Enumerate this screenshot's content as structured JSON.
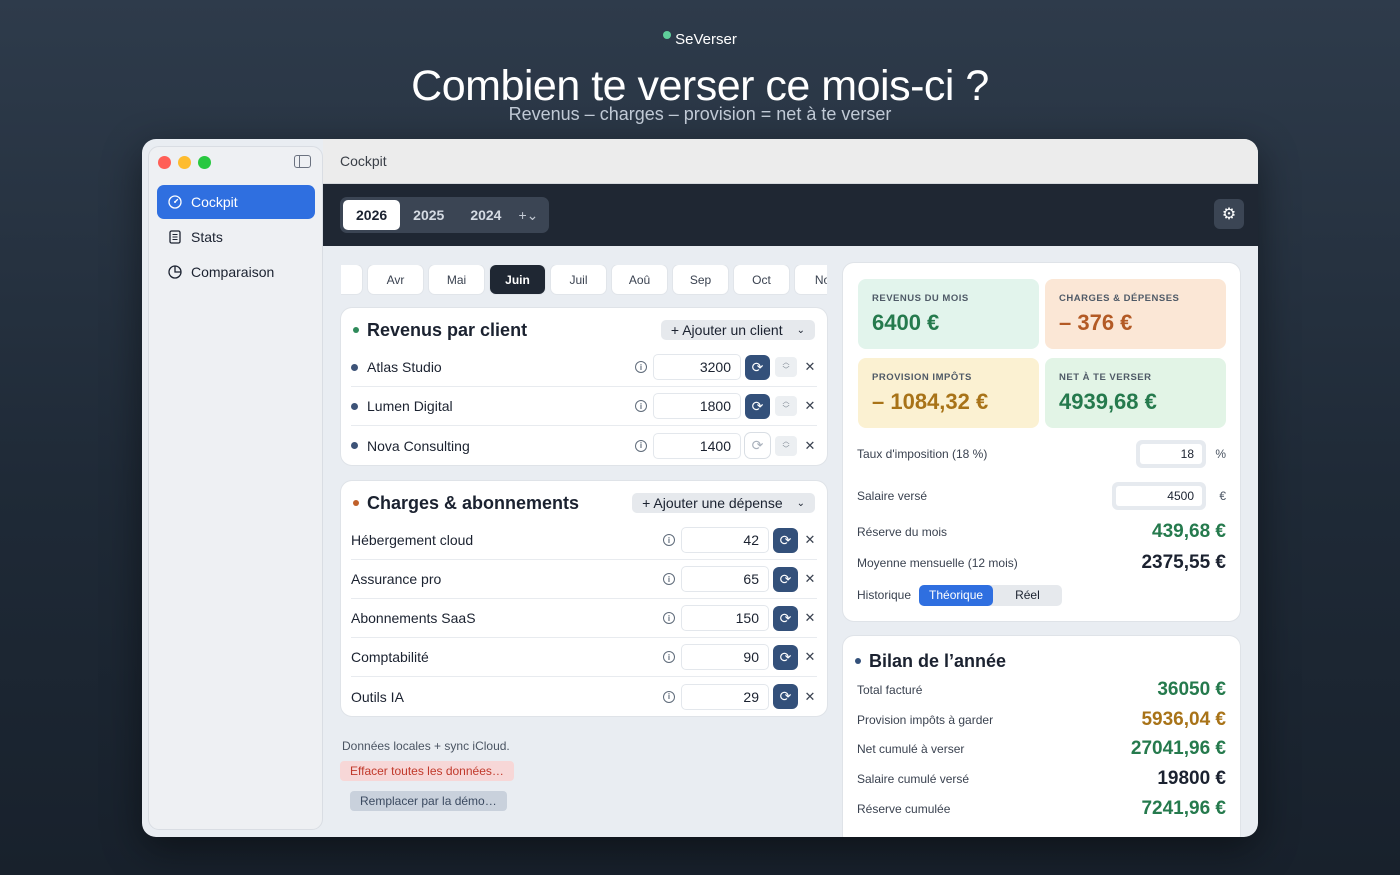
{
  "hero": {
    "brand": "SeVerser",
    "title": "Combien te verser ce mois-ci ?",
    "subtitle": "Revenus – charges – provision = net à te verser"
  },
  "sidebar": {
    "items": [
      {
        "label": "Cockpit",
        "icon": "gauge-icon"
      },
      {
        "label": "Stats",
        "icon": "document-icon"
      },
      {
        "label": "Comparaison",
        "icon": "pie-icon"
      }
    ]
  },
  "window": {
    "title": "Cockpit"
  },
  "years": {
    "items": [
      "2026",
      "2025",
      "2024"
    ],
    "selected": "2026",
    "add_label": "+⌄"
  },
  "months": {
    "items": [
      "ar",
      "Avr",
      "Mai",
      "Juin",
      "Juil",
      "Aoû",
      "Sep",
      "Oct",
      "No"
    ],
    "selected": "Juin"
  },
  "revenus": {
    "title": "Revenus par client",
    "add_label": "+ Ajouter un client",
    "rows": [
      {
        "name": "Atlas Studio",
        "amount": "3200"
      },
      {
        "name": "Lumen Digital",
        "amount": "1800"
      },
      {
        "name": "Nova Consulting",
        "amount": "1400"
      }
    ]
  },
  "charges": {
    "title": "Charges & abonnements",
    "add_label": "+ Ajouter une dépense",
    "rows": [
      {
        "name": "Hébergement cloud",
        "amount": "42"
      },
      {
        "name": "Assurance pro",
        "amount": "65"
      },
      {
        "name": "Abonnements SaaS",
        "amount": "150"
      },
      {
        "name": "Comptabilité",
        "amount": "90"
      },
      {
        "name": "Outils IA",
        "amount": "29"
      }
    ]
  },
  "footer": {
    "note": "Données locales + sync iCloud.",
    "erase_label": "Effacer toutes les données…",
    "demo_label": "Remplacer par la démo…"
  },
  "kpis": {
    "revenus": {
      "label": "REVENUS DU MOIS",
      "value": "6400 €"
    },
    "charges": {
      "label": "CHARGES & DÉPENSES",
      "value": "– 376 €"
    },
    "provision": {
      "label": "PROVISION IMPÔTS",
      "value": "– 1084,32 €"
    },
    "net": {
      "label": "NET À TE VERSER",
      "value": "4939,68 €"
    }
  },
  "params": {
    "taux_label": "Taux d'imposition (18 %)",
    "taux_value": "18",
    "taux_unit": "%",
    "salaire_label": "Salaire versé",
    "salaire_value": "4500",
    "salaire_unit": "€",
    "reserve_label": "Réserve du mois",
    "reserve_value": "439,68 €",
    "moyenne_label": "Moyenne mensuelle (12 mois)",
    "moyenne_value": "2375,55 €",
    "historique_label": "Historique",
    "historique_options": [
      "Théorique",
      "Réel"
    ],
    "historique_selected": "Théorique"
  },
  "bilan": {
    "title": "Bilan de l’année",
    "rows": [
      {
        "label": "Total facturé",
        "value": "36050 €"
      },
      {
        "label": "Provision impôts à garder",
        "value": "5936,04 €"
      },
      {
        "label": "Net cumulé à verser",
        "value": "27041,96 €"
      },
      {
        "label": "Salaire cumulé versé",
        "value": "19800 €"
      },
      {
        "label": "Réserve cumulée",
        "value": "7241,96 €"
      }
    ]
  },
  "colors": {
    "accent": "#2f6fe0",
    "toolbar": "#1f2733",
    "positive": "#257a4d",
    "warning": "#a87318",
    "negative": "#b35a25"
  }
}
